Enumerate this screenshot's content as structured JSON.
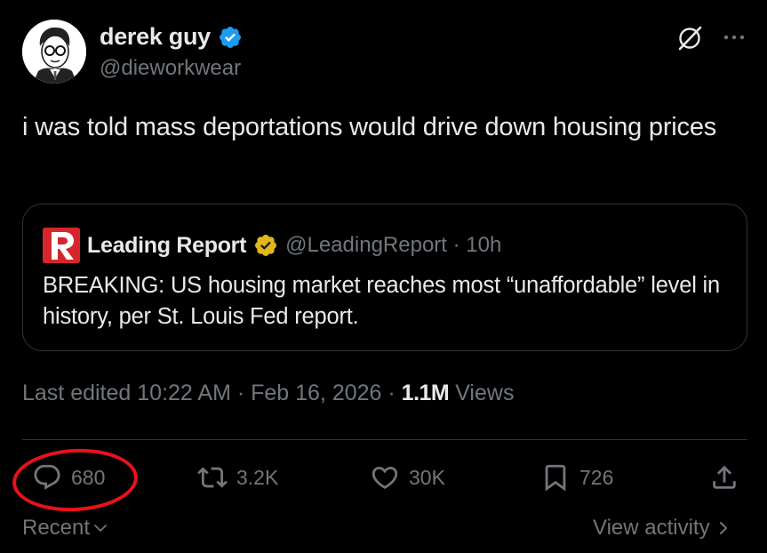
{
  "author": {
    "display_name": "derek guy",
    "handle": "@dieworkwear",
    "verified": true,
    "avatar_icon": "cartoon-portrait-avatar",
    "verified_color": "#1d9bf0"
  },
  "tweet": {
    "text": "i was told mass deportations would drive down housing prices"
  },
  "quote": {
    "logo_icon": "leading-report-logo",
    "logo_color": "#d7262b",
    "name": "Leading Report",
    "verified_badge": "gold-verified-badge",
    "verified_color": "#e2b719",
    "handle_time": "@LeadingReport · 10h",
    "text": "BREAKING: US housing market reaches most “unaffordable” level in history, per St. Louis Fed report."
  },
  "meta": {
    "edited": "Last edited 10:22 AM · Feb 16, 2026 · ",
    "views_count": "1.1M",
    "views_label": " Views"
  },
  "actions": {
    "replies": "680",
    "reposts": "3.2K",
    "likes": "30K",
    "bookmarks": "726"
  },
  "annotation": {
    "circle_color": "#e8121a",
    "target": "reply-count"
  },
  "footer": {
    "sort_label": "Recent",
    "view_activity_label": "View activity"
  }
}
